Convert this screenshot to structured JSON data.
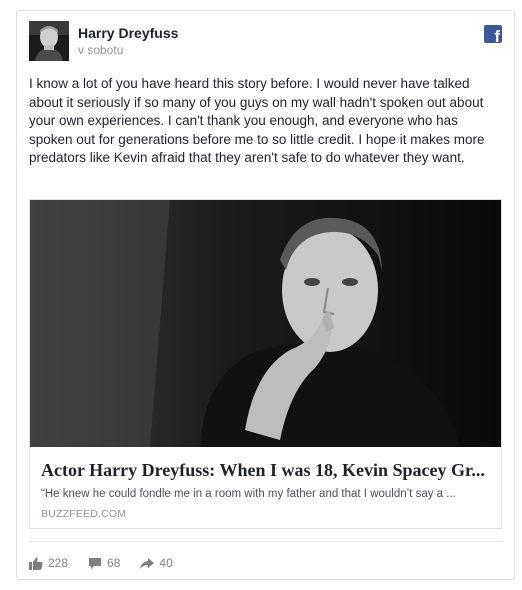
{
  "post": {
    "author": "Harry Dreyfuss",
    "timestamp": "v sobotu",
    "text": "I know a lot of you have heard this story before. I would never have talked about it seriously if so many of you guys on my wall hadn't spoken out about your own experiences. I can't thank you enough, and everyone who has spoken out for generations before me to so little credit. I hope it makes more predators like Kevin afraid that they aren't safe to do whatever they want."
  },
  "icons": {
    "platform": "facebook-icon",
    "like": "thumbs-up-icon",
    "comment": "comment-icon",
    "share": "share-arrow-icon"
  },
  "link": {
    "title": "Actor Harry Dreyfuss: When I was 18, Kevin Spacey Gr...",
    "description": "“He knew he could fondle me in a room with my father and that I wouldn’t say a ...",
    "domain": "BUZZFEED.COM"
  },
  "stats": {
    "likes": "228",
    "comments": "68",
    "shares": "40"
  },
  "colors": {
    "facebook_blue": "#3b5998",
    "text": "#1d2129",
    "muted": "#90949c",
    "border": "#dddfe2"
  }
}
